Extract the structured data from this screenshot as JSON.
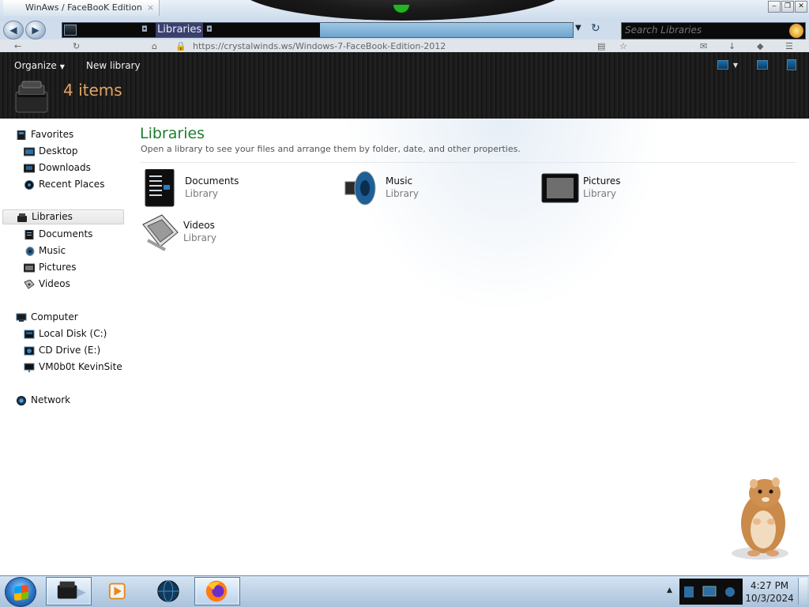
{
  "window": {
    "title": "WinAws / FaceBooK Edition",
    "close_tab": "×",
    "controls": {
      "minimize": "‒",
      "restore": "❐",
      "close": "✕"
    }
  },
  "address_bar": {
    "crumb": "Libraries",
    "separator": "◘",
    "search_placeholder": "Search Libraries"
  },
  "ghost_bar": {
    "url": "https://crystalwinds.ws/Windows-7-FaceBook-Edition-2012"
  },
  "toolbar": {
    "organize": "Organize",
    "new_library": "New library"
  },
  "header": {
    "item_count": "4 items"
  },
  "sidebar": {
    "favorites": {
      "label": "Favorites",
      "items": [
        "Desktop",
        "Downloads",
        "Recent Places"
      ]
    },
    "libraries": {
      "label": "Libraries",
      "items": [
        "Documents",
        "Music",
        "Pictures",
        "Videos"
      ]
    },
    "computer": {
      "label": "Computer",
      "items": [
        "Local Disk (C:)",
        "CD Drive (E:)",
        "VM0b0t KevinSite"
      ]
    },
    "network": {
      "label": "Network"
    }
  },
  "content": {
    "title": "Libraries",
    "subtitle": "Open a library to see your files and arrange them by folder, date, and other properties.",
    "libraries": [
      {
        "name": "Documents",
        "type": "Library",
        "icon": "documents-icon"
      },
      {
        "name": "Music",
        "type": "Library",
        "icon": "music-speaker-icon"
      },
      {
        "name": "Pictures",
        "type": "Library",
        "icon": "pictures-frame-icon"
      },
      {
        "name": "Videos",
        "type": "Library",
        "icon": "film-reel-icon"
      }
    ]
  },
  "taskbar": {
    "time": "4:27 PM",
    "date": "10/3/2024",
    "up_arrow": "▲"
  },
  "colors": {
    "content_title": "#1c7d2c",
    "item_count": "#e3a563",
    "header_bg": "#1a1a1a",
    "taskbar": "#a9c2db"
  }
}
